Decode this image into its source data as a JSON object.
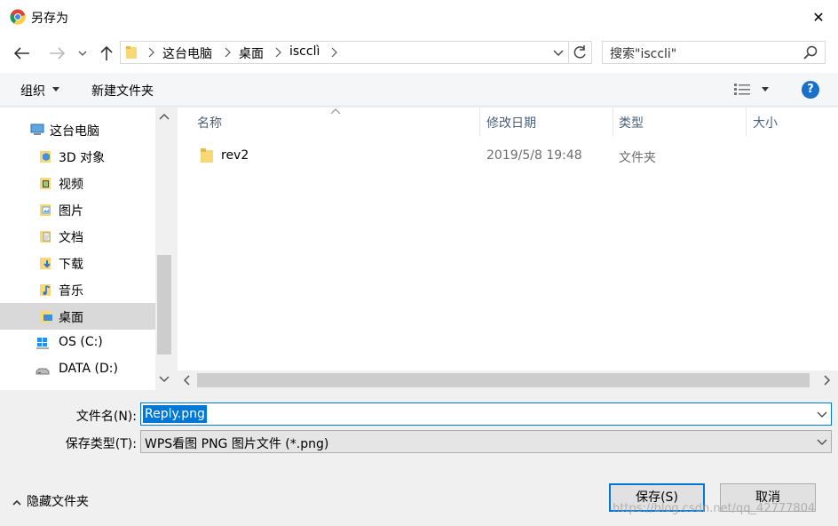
{
  "window": {
    "title": "另存为",
    "close_glyph": "✕"
  },
  "address": {
    "crumbs": [
      "这台电脑",
      "桌面",
      "iscclì"
    ],
    "search_placeholder": "搜索\"isccli\""
  },
  "toolbar": {
    "organize_label": "组织",
    "new_folder_label": "新建文件夹",
    "help_label": "?"
  },
  "nav": {
    "items": [
      {
        "label": "这台电脑",
        "icon": "computer-icon"
      },
      {
        "label": "3D 对象",
        "icon": "3d-objects-icon"
      },
      {
        "label": "视频",
        "icon": "videos-icon"
      },
      {
        "label": "图片",
        "icon": "pictures-icon"
      },
      {
        "label": "文档",
        "icon": "documents-icon"
      },
      {
        "label": "下载",
        "icon": "downloads-icon"
      },
      {
        "label": "音乐",
        "icon": "music-icon"
      },
      {
        "label": "桌面",
        "icon": "desktop-icon",
        "selected": true
      },
      {
        "label": "OS (C:)",
        "icon": "windows-drive-icon"
      },
      {
        "label": "DATA (D:)",
        "icon": "drive-icon"
      }
    ]
  },
  "files": {
    "columns": [
      "名称",
      "修改日期",
      "类型",
      "大小"
    ],
    "rows": [
      {
        "name": "rev2",
        "modified": "2019/5/8 19:48",
        "type": "文件夹",
        "size": ""
      }
    ]
  },
  "form": {
    "filename_label": "文件名(N):",
    "filename_value": "Reply.png",
    "filetype_label": "保存类型(T):",
    "filetype_value": "WPS看图 PNG 图片文件 (*.png)"
  },
  "footer": {
    "hide_folders_label": "隐藏文件夹",
    "save_label": "保存(S)",
    "cancel_label": "取消",
    "watermark": "https://blog.csdn.net/qq_42777804"
  },
  "colors": {
    "accent": "#0078d7",
    "folder": "#f8d775",
    "help": "#1a6fc9"
  }
}
